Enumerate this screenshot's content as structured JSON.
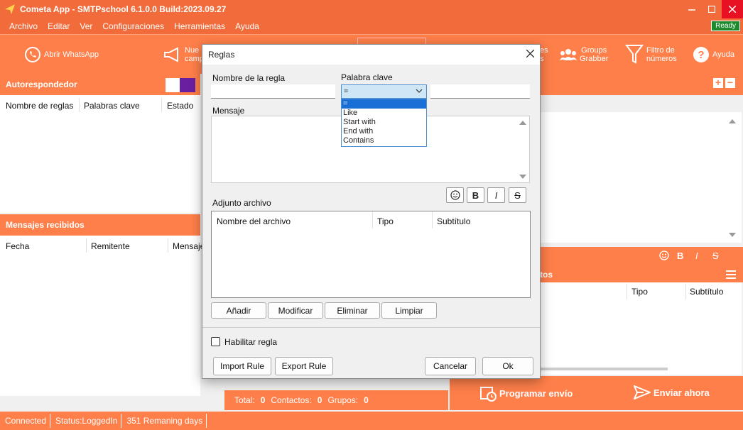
{
  "window": {
    "title": "Cometa App - SMTPschool 6.1.0.0 Build:2023.09.27"
  },
  "menu": [
    "Archivo",
    "Editar",
    "Ver",
    "Configuraciones",
    "Herramientas",
    "Ayuda"
  ],
  "ready": "Ready",
  "toolbar": {
    "whatsapp": "Abrir WhatsApp",
    "campaign_l1": "Nue",
    "campaign_l2": "campa",
    "hidden_l1": "es",
    "hidden_l2": "s",
    "groups_l1": "Groups",
    "groups_l2": "Grabber",
    "filter_l1": "Filtro de",
    "filter_l2": "números",
    "help": "Ayuda"
  },
  "left": {
    "auto_title": "Autorespondedor",
    "auto_cols": [
      "Nombre de reglas",
      "Palabras clave",
      "Estado"
    ],
    "msgs_title": "Mensajes recibidos",
    "msgs_cols": [
      "Fecha",
      "Remitente",
      "Mensaje"
    ]
  },
  "right": {
    "attach_title": "tos",
    "attach_cols": [
      "Tipo",
      "Subtítulo"
    ],
    "fmt_bold": "B",
    "fmt_italic": "I",
    "fmt_strike": "S"
  },
  "bottom": {
    "total_label": "Total:",
    "total": "0",
    "contacts_label": "Contactos:",
    "contacts": "0",
    "groups_label": "Grupos:",
    "groups": "0",
    "schedule": "Programar envío",
    "send": "Enviar ahora"
  },
  "status": [
    "Connected",
    "Status:LoggedIn",
    "351 Remaning days"
  ],
  "dialog": {
    "title": "Reglas",
    "rule_name_label": "Nombre de la regla",
    "keyword_label": "Palabra clave",
    "combo_value": "=",
    "options": [
      "=",
      "Like",
      "Start with",
      "End with",
      "Contains"
    ],
    "message_label": "Mensaje",
    "fmt_bold": "B",
    "fmt_italic": "I",
    "fmt_strike": "S",
    "attach_label": "Adjunto archivo",
    "attach_cols": [
      "Nombre del archivo",
      "Tipo",
      "Subtítulo"
    ],
    "btn_add": "Añadir",
    "btn_modify": "Modificar",
    "btn_delete": "Eliminar",
    "btn_clear": "Limpiar",
    "enable_label": "Habilitar regla",
    "btn_import": "Import Rule",
    "btn_export": "Export Rule",
    "btn_cancel": "Cancelar",
    "btn_ok": "Ok"
  }
}
